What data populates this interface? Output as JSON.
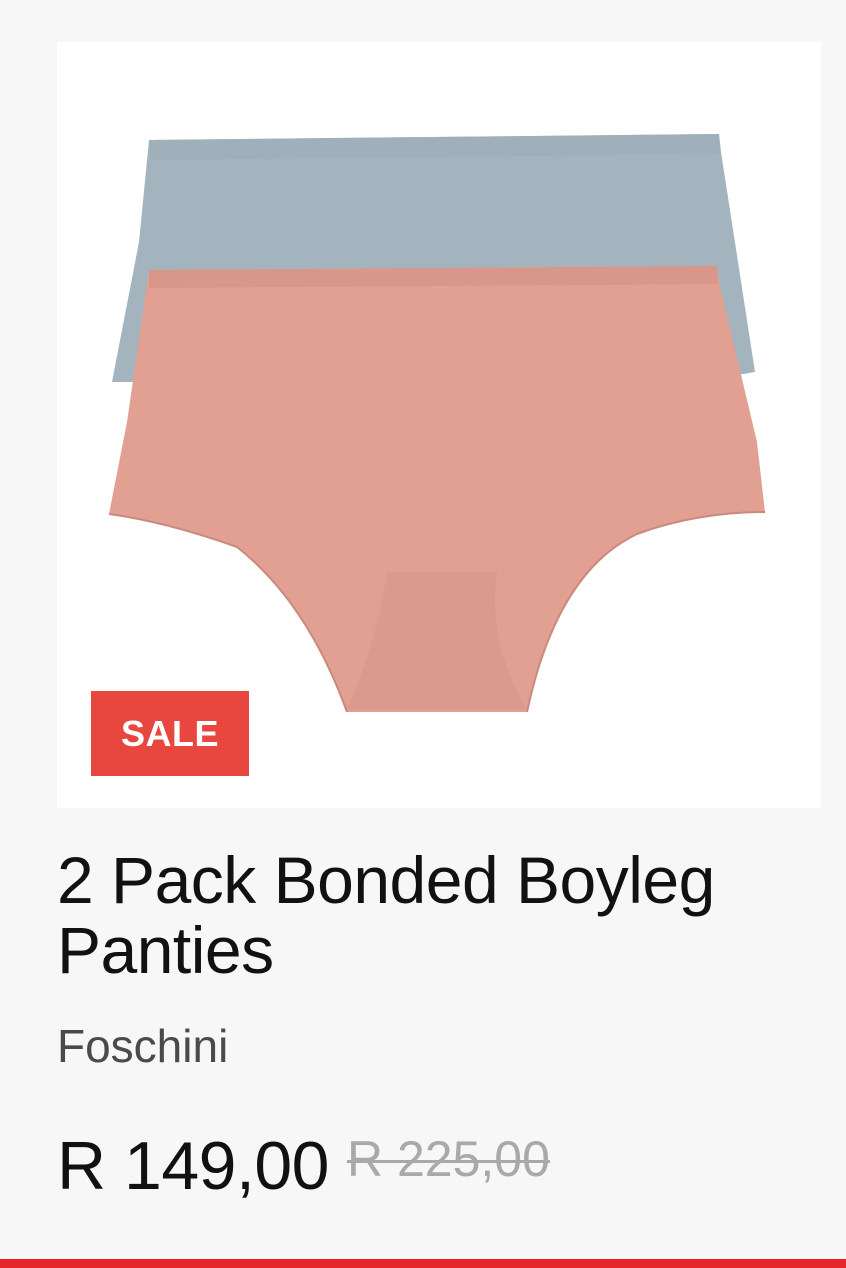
{
  "product": {
    "image_alt": "2 Pack Bonded Boyleg Panties - blue and pink",
    "badge": "SALE",
    "title": "2 Pack Bonded Boyleg Panties",
    "brand": "Foschini",
    "price_current": "R 149,00",
    "price_original": "R 225,00"
  },
  "colors": {
    "badge_bg": "#e8473f",
    "accent_bar": "#e5252a",
    "blue_garment": "#a3b4bf",
    "pink_garment": "#e1a091"
  }
}
